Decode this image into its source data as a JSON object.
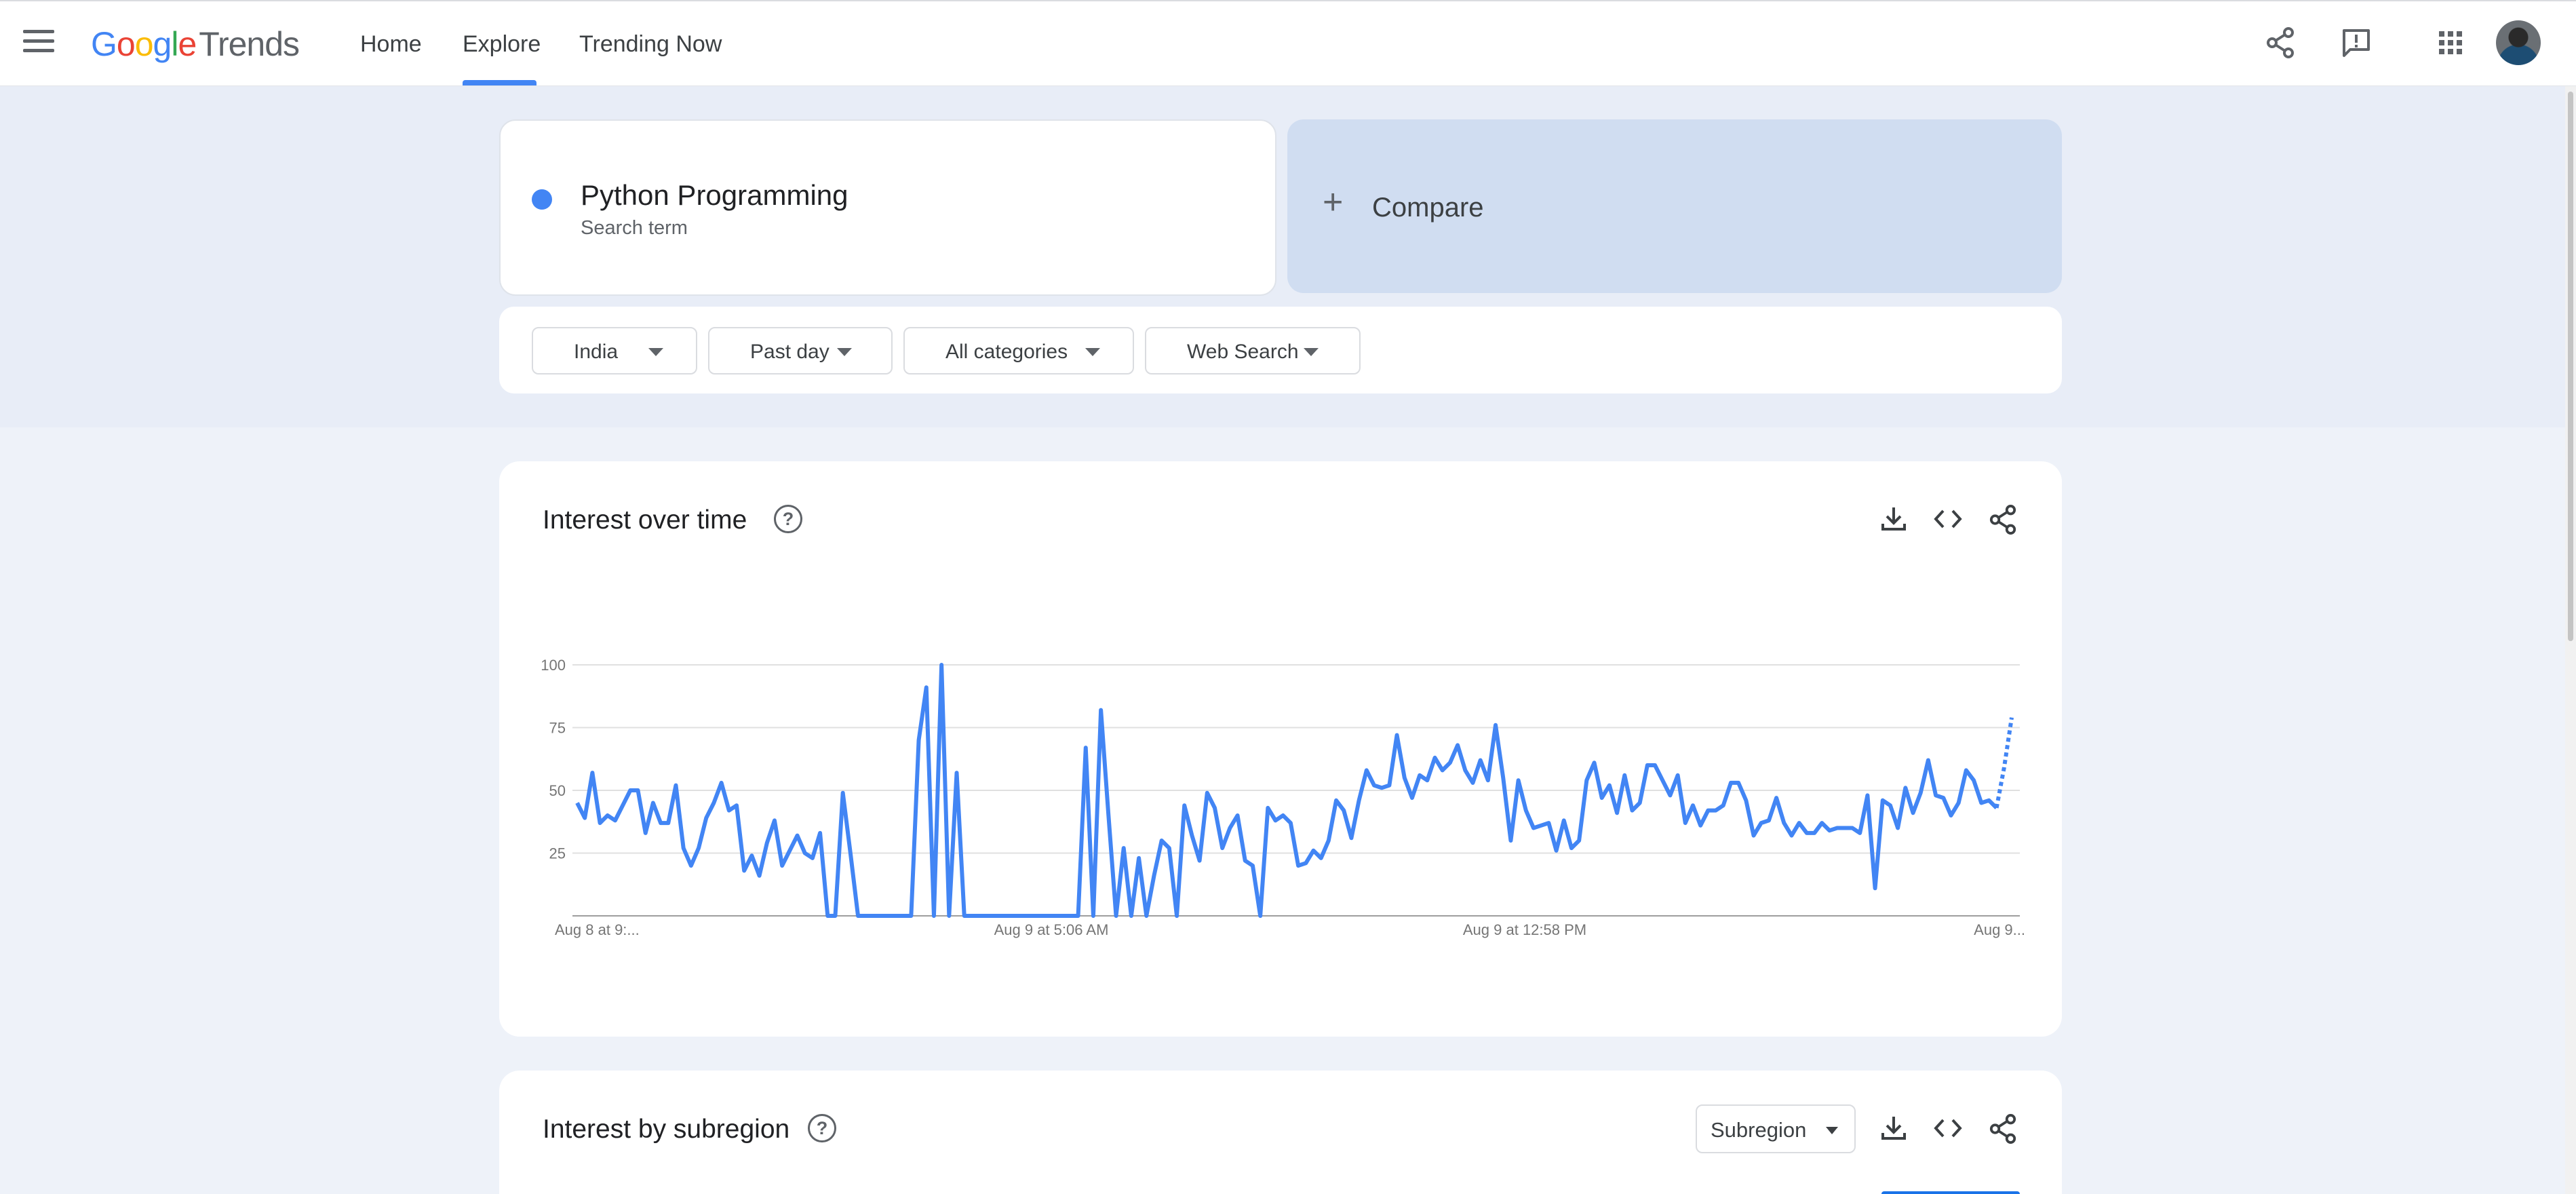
{
  "header": {
    "logo": {
      "google_letters": [
        "G",
        "o",
        "o",
        "g",
        "l",
        "e"
      ],
      "product": "Trends"
    },
    "nav_tabs": [
      {
        "label": "Home",
        "active": false
      },
      {
        "label": "Explore",
        "active": true
      },
      {
        "label": "Trending Now",
        "active": false
      }
    ],
    "icons": [
      "menu-icon",
      "share-icon",
      "feedback-icon",
      "apps-grid-icon",
      "account-avatar"
    ]
  },
  "search": {
    "term": {
      "value": "Python Programming",
      "type": "Search term",
      "color": "#4285f4"
    },
    "compare": {
      "icon": "plus-icon",
      "label": "Compare"
    }
  },
  "filters": [
    {
      "label": "India"
    },
    {
      "label": "Past day"
    },
    {
      "label": "All categories"
    },
    {
      "label": "Web Search"
    }
  ],
  "interest_over_time": {
    "title": "Interest over time",
    "actions": [
      "download-icon",
      "embed-code-icon",
      "share-icon"
    ]
  },
  "interest_by_subregion": {
    "title": "Interest by subregion",
    "select_value": "Subregion",
    "actions": [
      "download-icon",
      "embed-code-icon",
      "share-icon"
    ]
  },
  "colors": {
    "accent": "#4285f4",
    "page_background": "#eef2f9",
    "compare_background": "#d0ddf1"
  },
  "chart_data": {
    "type": "line",
    "title": "",
    "xlabel": "",
    "ylabel": "",
    "ylim": [
      0,
      100
    ],
    "yticks": [
      25,
      50,
      75,
      100
    ],
    "xtick_labels": [
      "Aug 8 at 9:...",
      "Aug 9 at 5:06 AM",
      "Aug 9 at 12:58 PM",
      "Aug 9..."
    ],
    "grid": true,
    "legend": "none",
    "line_color": "#4285f4",
    "partial_last_points": 3,
    "series": [
      {
        "values": [
          45,
          39,
          57,
          37,
          40,
          38,
          44,
          50,
          50,
          33,
          45,
          37,
          37,
          52,
          27,
          20,
          27,
          39,
          45,
          53,
          42,
          44,
          18,
          24,
          16,
          29,
          38,
          20,
          26,
          32,
          25,
          23,
          33,
          0,
          0,
          49,
          25,
          0,
          0,
          0,
          0,
          0,
          0,
          0,
          0,
          70,
          91,
          0,
          100,
          0,
          57,
          0,
          0,
          0,
          0,
          0,
          0,
          0,
          0,
          0,
          0,
          0,
          0,
          0,
          0,
          0,
          0,
          67,
          0,
          82,
          40,
          0,
          27,
          0,
          23,
          0,
          16,
          30,
          27,
          0,
          44,
          32,
          22,
          49,
          43,
          27,
          35,
          40,
          22,
          20,
          0,
          43,
          38,
          40,
          37,
          20,
          21,
          26,
          23,
          30,
          46,
          42,
          31,
          46,
          58,
          52,
          51,
          52,
          72,
          55,
          47,
          56,
          54,
          63,
          58,
          61,
          68,
          58,
          53,
          62,
          54,
          76,
          55,
          30,
          54,
          42,
          35,
          36,
          37,
          26,
          38,
          27,
          30,
          54,
          61,
          47,
          52,
          41,
          56,
          42,
          45,
          60,
          60,
          54,
          48,
          56,
          37,
          44,
          36,
          42,
          42,
          44,
          53,
          53,
          46,
          32,
          37,
          38,
          47,
          37,
          32,
          37,
          33,
          33,
          37,
          34,
          35,
          35,
          35,
          33,
          48,
          11,
          46,
          44,
          35,
          51,
          41,
          49,
          62,
          48,
          47,
          40,
          45,
          58,
          54,
          45,
          46,
          43,
          59,
          79
        ]
      }
    ]
  }
}
